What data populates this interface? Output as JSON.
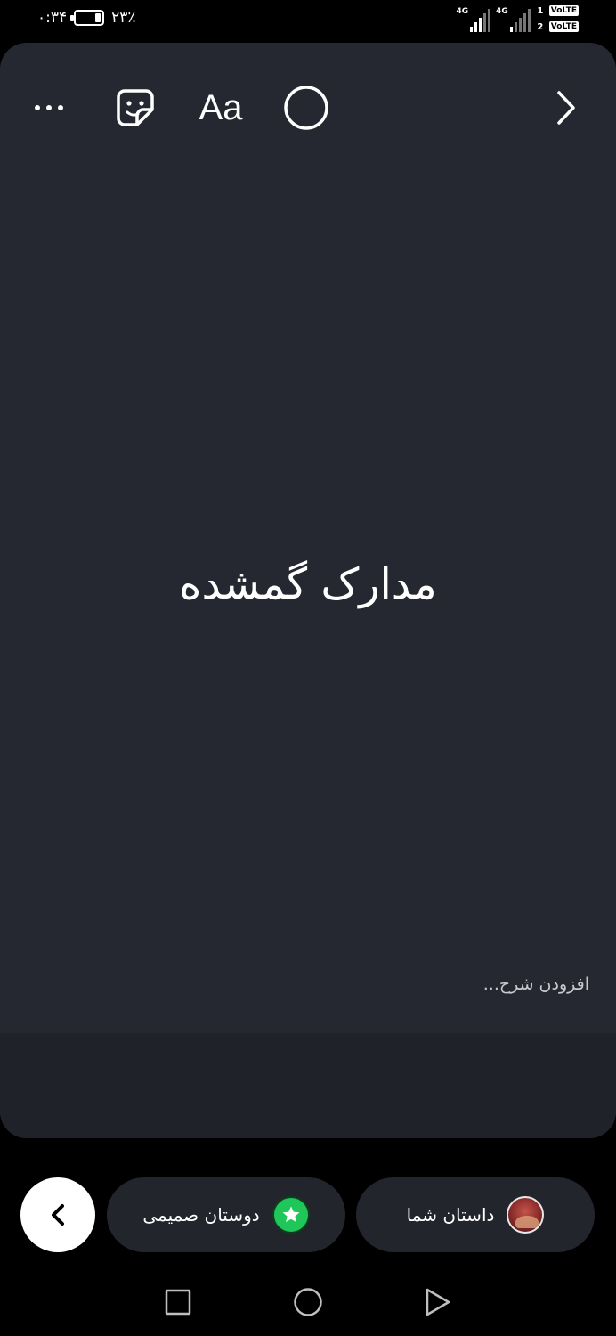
{
  "status_bar": {
    "time": "۰:۳۴",
    "battery_percent": "۲۳٪",
    "battery_level": 0.23,
    "networks": [
      {
        "label": "4G"
      },
      {
        "label": "4G"
      }
    ],
    "sims": [
      {
        "number": "1",
        "badge": "VoLTE"
      },
      {
        "number": "2",
        "badge": "VoLTE"
      }
    ]
  },
  "story_editor": {
    "toolbar": {
      "more_icon": "more-horizontal-icon",
      "sticker_icon": "sticker-icon",
      "text_tool_label": "Aa",
      "draw_icon": "circle-icon",
      "next_icon": "chevron-right-icon"
    },
    "story_text": "مدارک گمشده",
    "caption_placeholder": "افزودن شرح..."
  },
  "share_bar": {
    "close_friends_label": "دوستان صمیمی",
    "your_story_label": "داستان شما",
    "accent_green": "#1fc65a"
  },
  "colors": {
    "canvas": "#252830",
    "pill": "#22252c"
  }
}
